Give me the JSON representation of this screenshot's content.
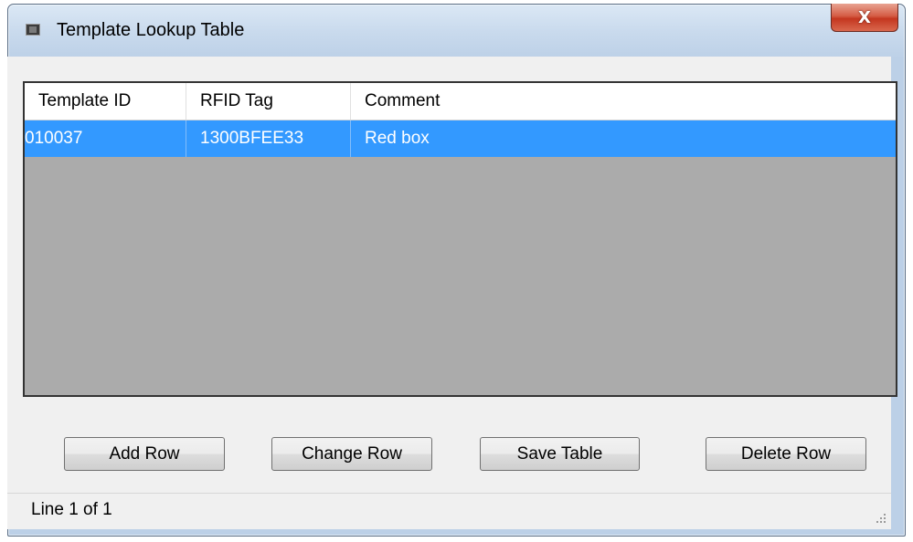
{
  "window": {
    "title": "Template Lookup Table",
    "close_label": "X"
  },
  "table": {
    "columns": [
      "Template ID",
      "RFID Tag",
      "Comment"
    ],
    "rows": [
      {
        "template_id": "010037",
        "rfid_tag": "1300BFEE33",
        "comment": "Red box",
        "selected": true
      }
    ]
  },
  "buttons": {
    "add_row": "Add Row",
    "change_row": "Change Row",
    "save_table": "Save Table",
    "delete_row": "Delete Row"
  },
  "status": {
    "text": "Line 1 of 1"
  },
  "colors": {
    "selection": "#3399ff",
    "empty_grid": "#ababab",
    "close_button": "#c4361f"
  }
}
